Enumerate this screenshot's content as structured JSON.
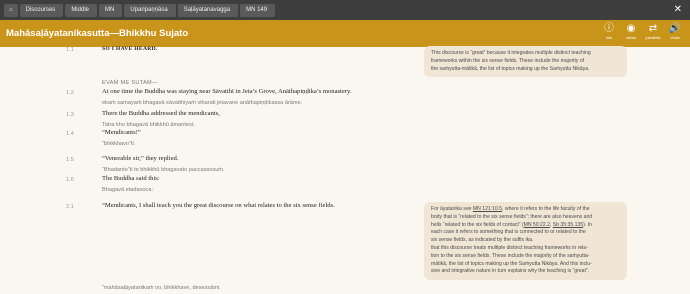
{
  "breadcrumbs": [
    "Discourses",
    "Middle",
    "MN",
    "Uparipaṇṇāsa",
    "Saḷāyatanavagga",
    "MN 149"
  ],
  "header": {
    "title": "Mahāsaḷāyatanikasutta—Bhikkhu Sujato"
  },
  "tools": [
    {
      "icon": "info-icon",
      "glyph": "ⓘ",
      "label": "info"
    },
    {
      "icon": "views-icon",
      "glyph": "◉",
      "label": "views"
    },
    {
      "icon": "parallels-icon",
      "glyph": "⇄",
      "label": "parallels"
    },
    {
      "icon": "voice-icon",
      "glyph": "🔊",
      "label": "Voice"
    }
  ],
  "lines": {
    "l1": {
      "num": "1.1",
      "en": "So I have heard."
    },
    "pali_head": "Evaṁ me sutaṁ—",
    "l2": {
      "num": "1.2",
      "en": "At one time the Buddha was staying near Sāvatthī in Jeta’s Grove, Anāthapiṇḍika’s monastery.",
      "pli": "ekaṁ samayaṁ bhagavā sāvatthiyaṁ viharati jetavane anāthapiṇḍikassa ārāme."
    },
    "l3": {
      "num": "1.3",
      "en": "There the Buddha addressed the mendicants,",
      "pli": "Tatra kho bhagavā bhikkhū āmantesi:"
    },
    "l4": {
      "num": "1.4",
      "en": "“Mendicants!”",
      "pli": "“bhikkhavo”ti."
    },
    "l5": {
      "num": "1.5",
      "en": "“Venerable sir,” they replied.",
      "pli": "“Bhadante”ti te bhikkhū bhagavato paccassosuṁ."
    },
    "l6": {
      "num": "1.6",
      "en": "The Buddha said this:",
      "pli": "Bhagavā etadavoca:"
    },
    "l7": {
      "num": "2.1",
      "en": "“Mendicants, I shall teach you the great discourse on what relates to the six sense fields."
    },
    "pali_bottom": "“mahāsaḷāyatanikaṁ vo, bhikkhave, desessāmi."
  },
  "notes": {
    "n1": [
      "This discourse is “great” because it integrates multiple distinct teaching",
      "frameworks within the six sense fields. These include the majority of",
      "the saṁyutta-mātikā, the list of topics making up the Saṁyutta Nikāya."
    ],
    "n2": {
      "p1": "For āyatanika see ",
      "link1": "MN 121:10.5",
      "p2": ", where it refers to the life faculty of the",
      "lines": [
        "body that is “related to the six sense fields”; there are also heavens and",
        "relates to something that is connected to or related to the six",
        "sense fields, as indicated by the suffix ika. Here this refers to the fact",
        "that this discourse treats multiple distinct teaching frameworks in rela-",
        "tion to the six sense fields. These include the majority of the saṁyutta-",
        "mātikā, the list of topics making up the Saṁyutta Nikāya. And this inclu-",
        "sive and integrative nature in turn explains why the teaching is “great”."
      ],
      "hells_a": "hells “related to the six fields of contact” (",
      "link2": "MN 50:22.2",
      "sep": ", ",
      "link3": "Sb 35:35.135",
      "hells_b": "). In",
      "each_a": "each case it refers to something that is connected to or related to the",
      "each_b": "six sense fields, as indicated by the suffix ika."
    }
  },
  "colors": {
    "topbar": "#3e3e3e",
    "titlebar": "#c8941a",
    "note_bg": "#f1e6d6",
    "page_bg": "#faf6f0"
  }
}
